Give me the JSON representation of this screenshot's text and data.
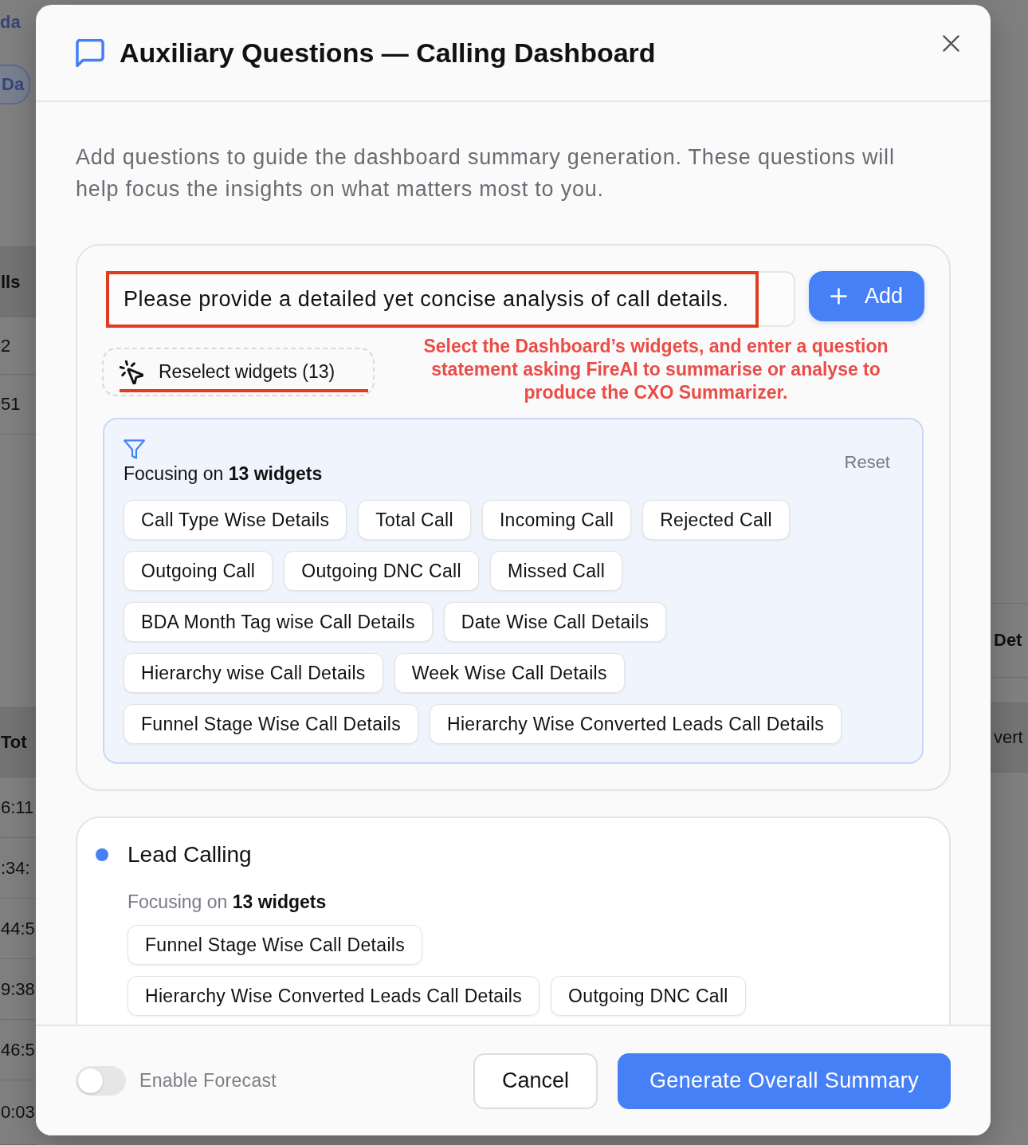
{
  "background": {
    "left": [
      {
        "text": "da",
        "kind": "link"
      },
      {
        "text": "Da",
        "kind": "pill"
      },
      {
        "text": "lls",
        "kind": "band"
      },
      {
        "text": "2",
        "kind": "cell"
      },
      {
        "text": "51",
        "kind": "cell"
      },
      {
        "text": "Tot",
        "kind": "band"
      },
      {
        "text": "6:11",
        "kind": "cell"
      },
      {
        "text": ":34:",
        "kind": "cell"
      },
      {
        "text": "44:5",
        "kind": "cell"
      },
      {
        "text": "9:38",
        "kind": "cell"
      },
      {
        "text": "46:5",
        "kind": "cell"
      },
      {
        "text": "0:03",
        "kind": "cell"
      }
    ],
    "right": [
      {
        "text": "Det",
        "kind": "heading"
      },
      {
        "text": "vert",
        "kind": "band"
      }
    ]
  },
  "modal": {
    "title": "Auxiliary Questions — Calling Dashboard",
    "description": "Add questions to guide the dashboard summary generation. These questions will help focus the insights on what matters most to you.",
    "question_input": {
      "value": "Please provide a detailed yet concise analysis of call details."
    },
    "add_button": {
      "label": "Add"
    },
    "reselect_button": {
      "label": "Reselect widgets (13)"
    },
    "annotation": {
      "note": "Select the Dashboard’s widgets, and enter a question statement asking FireAI to summarise or analyse to produce the CXO Summarizer."
    },
    "focus_panel": {
      "heading": "Focusing on **13 widgets**",
      "reset": "Reset",
      "widget_rows": [
        [
          "Call Type Wise Details",
          "Total Call",
          "Incoming Call",
          "Rejected Call"
        ],
        [
          "Outgoing Call",
          "Outgoing DNC Call",
          "Missed Call"
        ],
        [
          "BDA Month Tag wise Call Details",
          "Date Wise Call Details"
        ],
        [
          "Hierarchy wise Call Details",
          "Week Wise Call Details"
        ],
        [
          "Funnel Stage Wise Call Details",
          "Hierarchy Wise Converted Leads Call Details"
        ]
      ]
    },
    "questions": [
      {
        "title": "Lead Calling",
        "focus": "Focusing on **13 widgets**",
        "widget_rows": [
          [
            "Funnel Stage Wise Call Details"
          ],
          [
            "Hierarchy Wise Converted Leads Call Details",
            "Outgoing DNC Call"
          ]
        ]
      }
    ],
    "footer": {
      "forecast_toggle": {
        "label": "Enable Forecast",
        "on": false
      },
      "cancel": "Cancel",
      "generate": "Generate Overall Summary"
    }
  }
}
